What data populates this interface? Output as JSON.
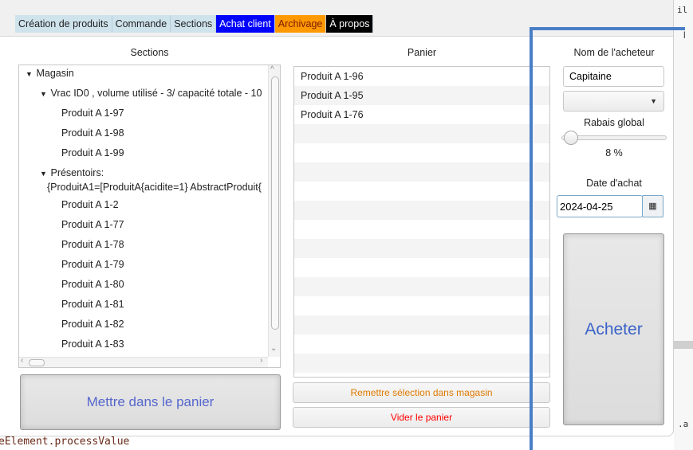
{
  "tabs": [
    {
      "label": "Création de produits",
      "style": "default"
    },
    {
      "label": "Commande",
      "style": "default"
    },
    {
      "label": "Sections",
      "style": "default"
    },
    {
      "label": "Achat client",
      "style": "blue"
    },
    {
      "label": "Archivage",
      "style": "orange"
    },
    {
      "label": "À propos",
      "style": "black"
    }
  ],
  "sections": {
    "header": "Sections",
    "tree": [
      {
        "label": "Magasin",
        "expanded": true
      },
      {
        "label": "Vrac ID0 , volume utilisé - 3/ capacité totale - 10",
        "expanded": true
      },
      {
        "label": "Produit A 1-97"
      },
      {
        "label": "Produit A 1-98"
      },
      {
        "label": "Produit A 1-99"
      },
      {
        "label": "Présentoirs:",
        "expanded": true
      },
      {
        "label": "{ProduitA1=[ProduitA{acidite=1} AbstractProduit{"
      },
      {
        "label": "Produit A 1-2"
      },
      {
        "label": "Produit A 1-77"
      },
      {
        "label": "Produit A 1-78"
      },
      {
        "label": "Produit A 1-79"
      },
      {
        "label": "Produit A 1-80"
      },
      {
        "label": "Produit A 1-81"
      },
      {
        "label": "Produit A 1-82"
      },
      {
        "label": "Produit A 1-83"
      }
    ],
    "add_button": "Mettre dans le panier"
  },
  "panier": {
    "header": "Panier",
    "items": [
      "Produit A 1-96",
      "Produit A 1-95",
      "Produit A 1-76"
    ],
    "remettre_button": "Remettre sélection dans magasin",
    "vider_button": "Vider le panier",
    "remettre_color": "#e07a00",
    "vider_color": "#ff0000"
  },
  "client": {
    "name_label": "Nom de l'acheteur",
    "name_value": "Capitaine",
    "discount_label": "Rabais global",
    "discount_value": "8 %",
    "discount_fraction": 0.08,
    "date_label": "Date d'achat",
    "date_value": "2024-04-25",
    "buy_button": "Acheter",
    "buy_color": "#3b63c8"
  },
  "background": {
    "bottom_code": "eElement.processValue",
    "right_top": "il",
    "right_small1": "ا",
    "right_small2": ".a"
  }
}
